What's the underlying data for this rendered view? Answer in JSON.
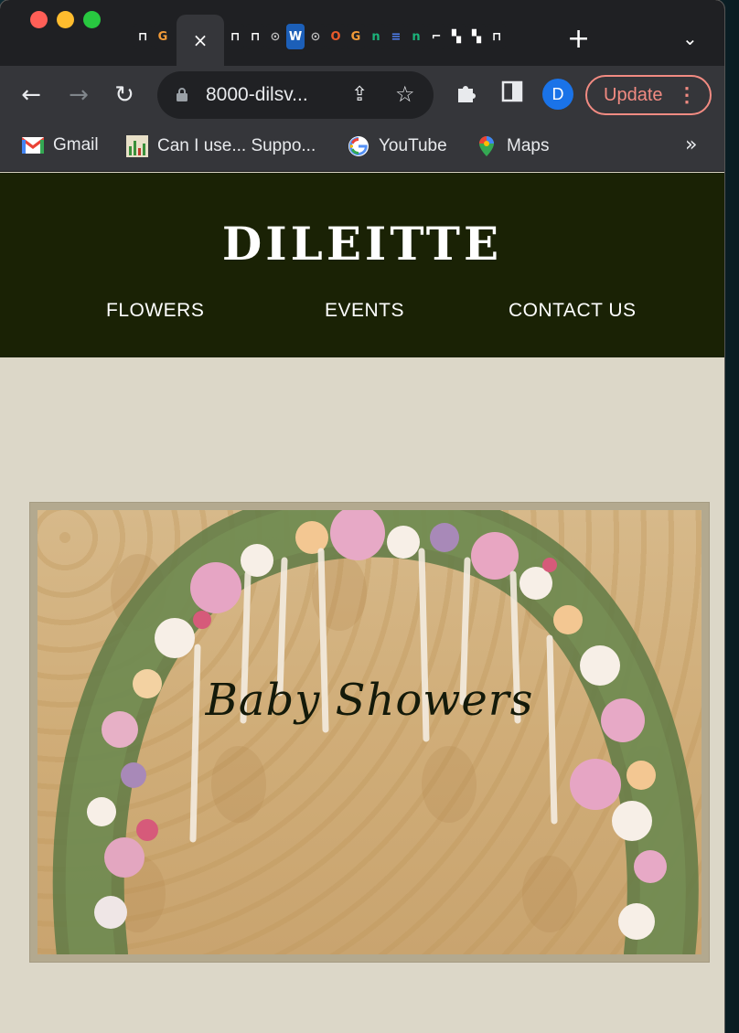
{
  "browser": {
    "url": "8000-dilsv...",
    "update_label": "Update",
    "avatar_letter": "D",
    "close_tab_glyph": "×",
    "new_tab_glyph": "+",
    "tab_icons": [
      {
        "glyph": "⊓",
        "color": "#ffffff",
        "bg": "#1f2023"
      },
      {
        "glyph": "G",
        "color": "#f29b38",
        "bg": "#1f2023"
      },
      {
        "glyph": "⊓",
        "color": "#ffffff",
        "bg": "#1f2023"
      },
      {
        "glyph": "⊓",
        "color": "#ffffff",
        "bg": "#1f2023"
      },
      {
        "glyph": "⊙",
        "color": "#bbbbbb",
        "bg": "#1f2023"
      },
      {
        "glyph": "W",
        "color": "#ffffff",
        "bg": "#1c5fb8"
      },
      {
        "glyph": "⊙",
        "color": "#bbbbbb",
        "bg": "#1f2023"
      },
      {
        "glyph": "O",
        "color": "#ea5a2a",
        "bg": "#1f2023"
      },
      {
        "glyph": "G",
        "color": "#f29b38",
        "bg": "#1f2023"
      },
      {
        "glyph": "n",
        "color": "#1bb37a",
        "bg": "#1f2023"
      },
      {
        "glyph": "≡",
        "color": "#4f7ff0",
        "bg": "#1f2023"
      },
      {
        "glyph": "n",
        "color": "#1bb37a",
        "bg": "#1f2023"
      },
      {
        "glyph": "⌐",
        "color": "#ffffff",
        "bg": "#1f2023"
      },
      {
        "glyph": "▚",
        "color": "#ffffff",
        "bg": "#1f2023"
      },
      {
        "glyph": "▚",
        "color": "#ffffff",
        "bg": "#1f2023"
      },
      {
        "glyph": "⊓",
        "color": "#ffffff",
        "bg": "#1f2023"
      }
    ],
    "bookmarks": [
      {
        "label": "Gmail",
        "icon": "gmail-icon"
      },
      {
        "label": "Can I use... Suppo...",
        "icon": "caniuse-icon"
      },
      {
        "label": "YouTube",
        "icon": "google-icon"
      },
      {
        "label": "Maps",
        "icon": "maps-icon"
      }
    ],
    "bookmarks_more": "»"
  },
  "site": {
    "logo": "DILEITTE",
    "nav": [
      "FLOWERS",
      "EVENTS",
      "CONTACT US"
    ],
    "hero_title": "Baby Showers"
  },
  "colors": {
    "header_bg": "#1a2205",
    "page_bg": "#dcd7c8",
    "frame": "#b3a98f",
    "update_accent": "#f28b82"
  }
}
